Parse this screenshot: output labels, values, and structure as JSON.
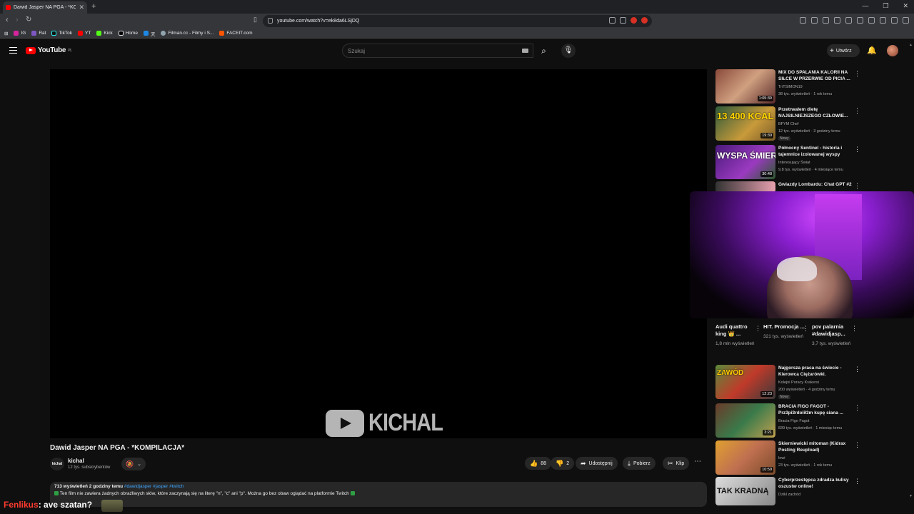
{
  "browser": {
    "tab_title": "Dawid Jasper NA PGA - *KOM",
    "url": "youtube.com/watch?v=ek8da6LSjDQ",
    "bookmarks": [
      "IG",
      "Rat",
      "TikTok",
      "YT",
      "Kick",
      "Home",
      "天",
      "Filman.cc - Filmy i S...",
      "FACEIT.com"
    ]
  },
  "masthead": {
    "logo_text": "YouTube",
    "logo_region": "PL",
    "search_placeholder": "Szukaj",
    "create_label": "Utwórz"
  },
  "player": {
    "watermark": "KICHAL"
  },
  "video": {
    "title": "Dawid Jasper NA PGA - *KOMPILACJA*",
    "channel_avatar_text": "kichal",
    "channel": "kichal",
    "subscribers": "12 tys. subskrybentów",
    "likes": "88",
    "dislikes": "2",
    "share_label": "Udostępnij",
    "download_label": "Pobierz",
    "clip_label": "Klip",
    "views_time": "713 wyświetleń  2 godziny temu",
    "hashtags": "#dawidjasper #jasper #twitch",
    "description": "Ten film nie zawiera żadnych obraźliwych słów, które zaczynają się na literę \"n\", \"c\" ani \"p\". Można go bez obaw oglądać na platformie Twitch"
  },
  "recommendations_top": [
    {
      "title": "MIX DO SPALANIA KALORII NA SIŁCE W PRZERWIE OD PICIA ...",
      "channel": "TriTSIMON19",
      "meta": "38 tys. wyświetleń · 1 rok temu",
      "duration": "1:05:39",
      "badge": "",
      "thumb_text": "",
      "color": "#7a3b2a"
    },
    {
      "title": "Przetrwałem dietę NAJSILNIEJSZEGO CZŁOWIE...",
      "channel": "BFYM Chef",
      "meta": "12 tys. wyświetleń · 3 godziny temu",
      "duration": "19:39",
      "badge": "Nowy",
      "thumb_text": "13 400 KCAL",
      "color": "#3f6b3a"
    },
    {
      "title": "Północny Sentinel - historia i tajemnice izolowanej wyspy",
      "channel": "Interesujący Świat",
      "meta": "9,8 tys. wyświetleń · 4 miesiące temu",
      "duration": "30:48",
      "badge": "",
      "thumb_text": "WYSPA ŚMIERCI",
      "color": "#5b2a8a"
    },
    {
      "title": "Gwiazdy Lombardu: Chat GPT #2",
      "channel": "",
      "meta": "",
      "duration": "",
      "badge": "",
      "thumb_text": "",
      "color": "#c26a7a"
    }
  ],
  "shorts": [
    {
      "title": "Audi quattro king 👑 ...",
      "views": "1,8 mln wyświetleń"
    },
    {
      "title": "HIT. Promocja ...",
      "views": "321 tys. wyświetleń"
    },
    {
      "title": "pov palarnia #dawidjasp...",
      "views": "3,7 tys. wyświetleń"
    }
  ],
  "recommendations_bottom": [
    {
      "title": "Najgorsza praca na świecie - Kierowca Ciężarówki.",
      "channel": "Kolejni Poracy Krakersi",
      "meta": "200 wyświetleń · 4 godziny temu",
      "duration": "12:23",
      "badge": "Nowy",
      "thumb_text": "ZAWÓD",
      "color": "#7a2a22"
    },
    {
      "title": "BRACIA FIGO FAGOT - Prz3pi3rdolił3m kupę siana ...",
      "channel": "Bracia Figo Fagot",
      "meta": "839 tys. wyświetleń · 1 miesiąc temu",
      "duration": "3:21",
      "badge": "",
      "thumb_text": "",
      "color": "#2f5b3a"
    },
    {
      "title": "Skierniewicki mitoman (Kidrax Posting Reupload)",
      "channel": "lewi",
      "meta": "23 tys. wyświetleń · 1 rok temu",
      "duration": "10:59",
      "badge": "",
      "thumb_text": "",
      "color": "#b07a2a"
    },
    {
      "title": "Cyberprzestępca zdradza kulisy oszustw online!",
      "channel": "Dzikl zachód",
      "meta": "",
      "duration": "",
      "badge": "",
      "thumb_text": "TAK KRADNĄ",
      "color": "#8a8a8a"
    }
  ],
  "chat_overlay": {
    "user": "Fenlikus",
    "message": ": ave szatan?"
  }
}
